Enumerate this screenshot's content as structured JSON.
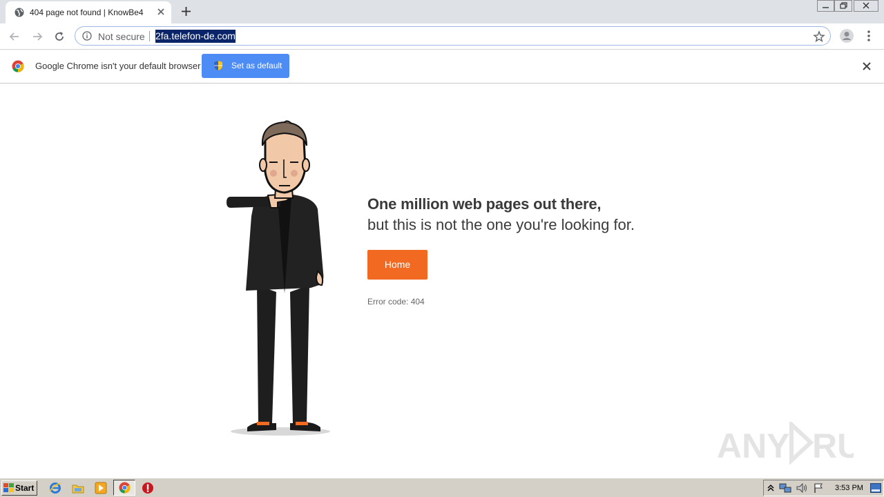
{
  "tab": {
    "title": "404 page not found | KnowBe4"
  },
  "omnibox": {
    "security_label": "Not secure",
    "url": "2fa.telefon-de.com"
  },
  "infobar": {
    "message": "Google Chrome isn't your default browser",
    "button_label": "Set as default"
  },
  "page": {
    "headline_line1": "One million web pages out there,",
    "headline_line2": "but this is not the one you're looking for.",
    "home_button": "Home",
    "error_code": "Error code: 404"
  },
  "watermark": {
    "text": "ANY RUN"
  },
  "taskbar": {
    "start_label": "Start",
    "clock": "3:53 PM"
  },
  "colors": {
    "accent_orange": "#f26a21",
    "chrome_blue": "#4d8bf5",
    "url_highlight": "#0a246a"
  }
}
